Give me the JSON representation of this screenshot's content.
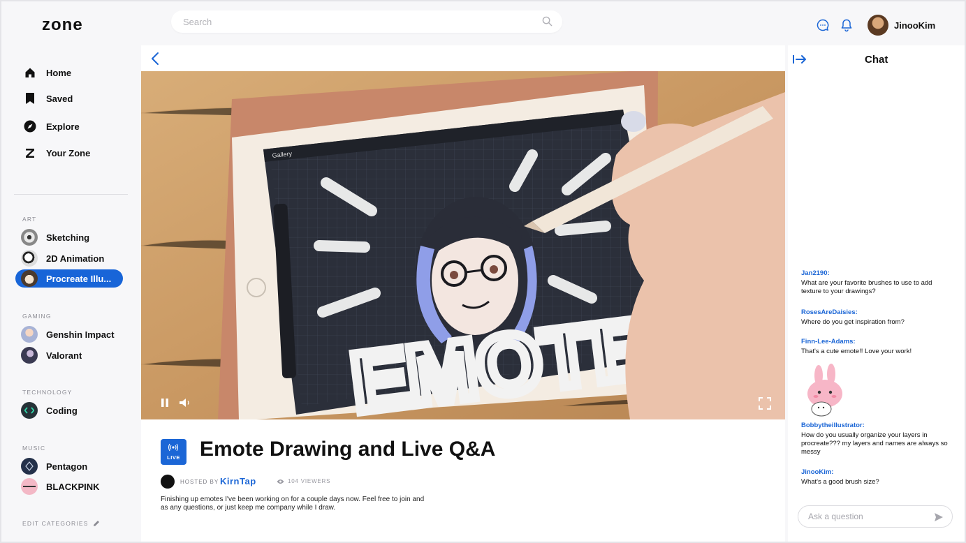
{
  "app": {
    "logo": "zone",
    "accent": "#1b66d6"
  },
  "header": {
    "search_placeholder": "Search",
    "username": "JinooKim"
  },
  "sidebar": {
    "nav": [
      {
        "label": "Home",
        "icon": "home-icon"
      },
      {
        "label": "Saved",
        "icon": "bookmark-icon"
      },
      {
        "label": "Explore",
        "icon": "compass-icon"
      },
      {
        "label": "Your Zone",
        "icon": "zone-z-icon"
      }
    ],
    "sections": [
      {
        "title": "ART",
        "items": [
          "Sketching",
          "2D Animation",
          "Procreate Illu..."
        ]
      },
      {
        "title": "GAMING",
        "items": [
          "Genshin Impact",
          "Valorant"
        ]
      },
      {
        "title": "TECHNOLOGY",
        "items": [
          "Coding"
        ]
      },
      {
        "title": "MUSIC",
        "items": [
          "Pentagon",
          "BLACKPINK"
        ]
      }
    ],
    "active_item": "Procreate Illu...",
    "edit_label": "EDIT CATEGORIES"
  },
  "stream": {
    "video_overlay": {
      "gallery_label": "Gallery",
      "canvas_text": "EMOTE"
    },
    "live_label": "LIVE",
    "title": "Emote Drawing and Live Q&A",
    "hosted_by_label": "HOSTED BY",
    "host": "KirnTap",
    "viewers": "104 VIEWERS",
    "description": "Finishing up emotes I've been working on for a couple days now. Feel free to join and as any questions, or just keep me company while I draw."
  },
  "chat": {
    "title": "Chat",
    "messages": [
      {
        "user": "Jan2190:",
        "text": "What are your favorite brushes to use to add texture to your drawings?"
      },
      {
        "user": "RosesAreDaisies:",
        "text": "Where do you get inspiration from?"
      },
      {
        "user": "Finn-Lee-Adams:",
        "text": "That's a cute emote!! Love your work!"
      },
      {
        "user": "Bobbytheillustrator:",
        "text": "How do you usually organize your layers in procreate??? my layers and names are always so messy"
      },
      {
        "user": "JinooKim:",
        "text": "What's a good brush size?"
      }
    ],
    "input_placeholder": "Ask a question"
  }
}
